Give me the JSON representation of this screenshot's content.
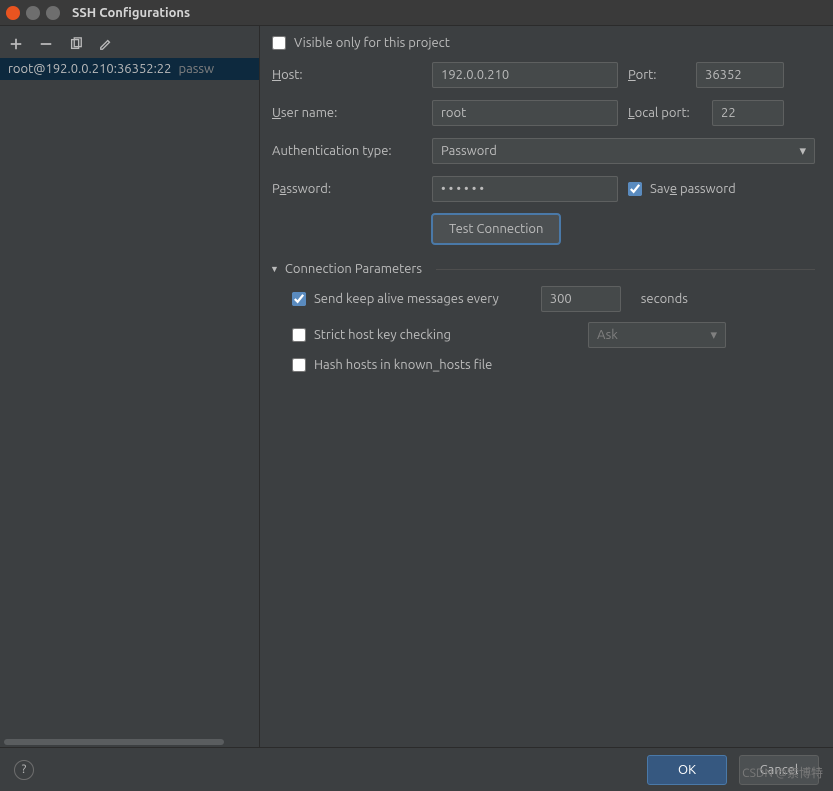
{
  "window": {
    "title": "SSH Configurations"
  },
  "toolbar": {
    "add": "add",
    "remove": "remove",
    "copy": "copy",
    "edit": "edit"
  },
  "list": {
    "items": [
      {
        "label": "root@192.0.0.210:36352:22",
        "type": "passw"
      }
    ]
  },
  "form": {
    "visible_only_label": "Visible only for this project",
    "visible_only": false,
    "host_label": "Host:",
    "host": "192.0.0.210",
    "port_label": "Port:",
    "port": "36352",
    "user_label": "User name:",
    "user": "root",
    "local_port_label": "Local port:",
    "local_port": "22",
    "auth_label": "Authentication type:",
    "auth_value": "Password",
    "password_label": "Password:",
    "password": "••••••",
    "save_password_label": "Save password",
    "save_password": true,
    "test_button": "Test Connection"
  },
  "params": {
    "header": "Connection Parameters",
    "keepalive_label": "Send keep alive messages every",
    "keepalive": true,
    "keepalive_value": "300",
    "keepalive_unit": "seconds",
    "strict_label": "Strict host key checking",
    "strict": false,
    "strict_mode": "Ask",
    "hash_label": "Hash hosts in known_hosts file",
    "hash": false
  },
  "footer": {
    "ok": "OK",
    "cancel": "Cancel",
    "watermark": "CSDN @索博特"
  }
}
